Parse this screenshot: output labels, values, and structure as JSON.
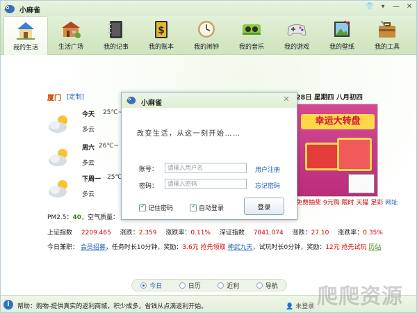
{
  "app": {
    "title": "小麻雀",
    "window_buttons": [
      "👕",
      "▾",
      "—",
      "✕"
    ]
  },
  "toolbar": {
    "items": [
      {
        "label": "我的生活",
        "icon": "house-icon",
        "active": true
      },
      {
        "label": "生活广场",
        "icon": "plaza-icon",
        "active": false
      },
      {
        "label": "我的记事",
        "icon": "notebook-icon",
        "active": false
      },
      {
        "label": "我的账本",
        "icon": "ledger-icon",
        "active": false
      },
      {
        "label": "我的闹钟",
        "icon": "clock-icon",
        "active": false
      },
      {
        "label": "我的音乐",
        "icon": "music-icon",
        "active": false
      },
      {
        "label": "我的游戏",
        "icon": "gamepad-icon",
        "active": false
      },
      {
        "label": "我的壁纸",
        "icon": "wallpaper-icon",
        "active": false
      },
      {
        "label": "我的工具",
        "icon": "toolbox-icon",
        "active": false
      }
    ]
  },
  "weather": {
    "city": "厦门",
    "customize": "[定制]",
    "date": "28日 星期四 八月初四",
    "days": [
      {
        "day": "今天",
        "temp": "25℃~",
        "desc": "多云"
      },
      {
        "day": "周六",
        "temp": "26℃~",
        "desc": "多云"
      },
      {
        "day": "下周一",
        "temp": "25℃",
        "desc": "多云"
      }
    ]
  },
  "ad": {
    "title": "幸运大转盘",
    "links": {
      "free": "免费抽奖",
      "nine": "9元购",
      "flash": "限时",
      "tmall": "天猫",
      "lottery": "足彩",
      "web": "网址"
    }
  },
  "pm": {
    "label": "PM2.5：",
    "value": "40",
    "air": "，空气质量："
  },
  "stocks": {
    "sh_label": "上证指数",
    "sh_value": "2209.465",
    "sh_change_label": "涨跌：",
    "sh_change": "2.359",
    "sh_rate_label": "涨跌率：",
    "sh_rate": "0.11%",
    "sz_label": "深证指数",
    "sz_value": "7841.074",
    "sz_change_label": "涨跌：",
    "sz_change": "27.10",
    "sz_rate_label": "涨跌率：",
    "sz_rate": "0.35%"
  },
  "jobs": {
    "label": "今日兼职：",
    "job1_name": "会员招募",
    "job1_desc": "，任务时长10分钟，奖励：",
    "job1_reward": "3.6元",
    "job1_action": "抢先领取",
    "job2_name": "神武九天",
    "job2_desc": "，试玩时长0分钟，奖励：",
    "job2_reward": "12元",
    "job2_action": "抢先试玩",
    "more": "历站"
  },
  "tabs": [
    {
      "label": "今日",
      "active": true
    },
    {
      "label": "日历",
      "active": false
    },
    {
      "label": "近利",
      "active": false
    },
    {
      "label": "导航",
      "active": false
    }
  ],
  "status": {
    "help": "帮助：购物-提供真实的返利商城，积少成多，省钱从点滴返利开始。",
    "login": "未登录"
  },
  "watermark": "爬爬资源",
  "dialog": {
    "title": "小麻雀",
    "close": "✕",
    "slogan": "改变生活，从这一刻开始……",
    "account_label": "账号：",
    "account_placeholder": "请输入用户名",
    "register_link": "用户注册",
    "password_label": "密码：",
    "password_placeholder": "请输入密码",
    "forgot_link": "忘记密码",
    "remember_label": "记住密码",
    "auto_login_label": "自动登录",
    "login_button": "登录"
  },
  "colors": {
    "accent": "#1d5fb4",
    "red": "#d40000",
    "green": "#2e8b00",
    "city": "#d04a00"
  }
}
